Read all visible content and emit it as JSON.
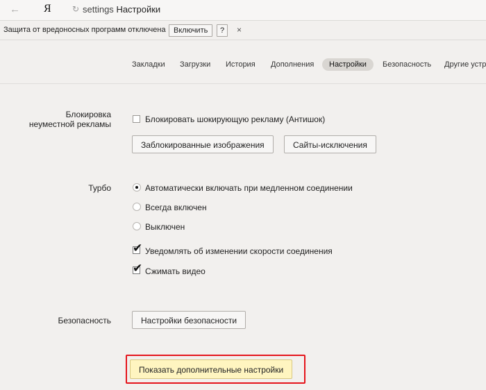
{
  "browser": {
    "logo": "Я",
    "url_protocol": "settings",
    "url_title": "Настройки"
  },
  "infobar": {
    "message": "Защита от вредоносных программ отключена",
    "enable_label": "Включить",
    "help_label": "?",
    "close_label": "×"
  },
  "nav": {
    "tabs": [
      {
        "label": "Закладки"
      },
      {
        "label": "Загрузки"
      },
      {
        "label": "История"
      },
      {
        "label": "Дополнения"
      },
      {
        "label": "Настройки"
      },
      {
        "label": "Безопасность"
      },
      {
        "label": "Другие устр"
      }
    ],
    "active_tab": "Настройки"
  },
  "ad_block": {
    "label": "Блокировка\nнеуместной рекламы",
    "checkbox_label": "Блокировать шокирующую рекламу (Антишок)",
    "checked": false,
    "blocked_images_button": "Заблокированные изображения",
    "exceptions_button": "Сайты-исключения"
  },
  "turbo": {
    "label": "Турбо",
    "options": [
      {
        "label": "Автоматически включать при медленном соединении",
        "selected": true
      },
      {
        "label": "Всегда включен",
        "selected": false
      },
      {
        "label": "Выключен",
        "selected": false
      }
    ],
    "notify_speed_label": "Уведомлять об изменении скорости соединения",
    "notify_speed_checked": true,
    "compress_video_label": "Сжимать видео",
    "compress_video_checked": true
  },
  "security": {
    "label": "Безопасность",
    "button": "Настройки безопасности"
  },
  "show_more_button": "Показать дополнительные настройки",
  "colors": {
    "highlight": "#e5131a",
    "primary_button_bg": "#fff5c0",
    "active_tab_bg": "#d9d6d2"
  }
}
